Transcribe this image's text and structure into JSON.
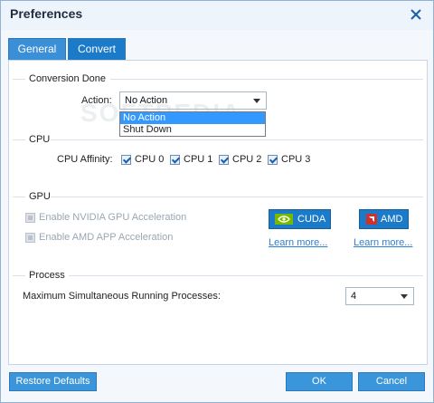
{
  "window": {
    "title": "Preferences",
    "close_icon": "close-icon"
  },
  "tabs": [
    {
      "label": "General",
      "active": false
    },
    {
      "label": "Convert",
      "active": true
    }
  ],
  "conversion_done": {
    "title": "Conversion Done",
    "action_label": "Action:",
    "action_value": "No Action",
    "dropdown_options": [
      "No Action",
      "Shut Down"
    ],
    "highlighted_option": "No Action"
  },
  "cpu": {
    "title": "CPU",
    "affinity_label": "CPU Affinity:",
    "cores": [
      {
        "label": "CPU 0",
        "checked": true
      },
      {
        "label": "CPU 1",
        "checked": true
      },
      {
        "label": "CPU 2",
        "checked": true
      },
      {
        "label": "CPU 3",
        "checked": true
      }
    ]
  },
  "gpu": {
    "title": "GPU",
    "nvidia_label": "Enable NVIDIA GPU Acceleration",
    "amd_label": "Enable AMD APP Acceleration",
    "cuda_button": "CUDA",
    "amd_button": "AMD",
    "learn_more_cuda": "Learn more...",
    "learn_more_amd": "Learn more..."
  },
  "process": {
    "title": "Process",
    "max_label": "Maximum Simultaneous Running Processes:",
    "max_value": "4"
  },
  "footer": {
    "restore_defaults": "Restore Defaults",
    "ok": "OK",
    "cancel": "Cancel"
  },
  "watermark": "SOFTPEDIA",
  "colors": {
    "accent": "#1b7bc9",
    "link": "#2a7fd4",
    "nvidia_green": "#76b900",
    "amd_red": "#d0312d"
  }
}
